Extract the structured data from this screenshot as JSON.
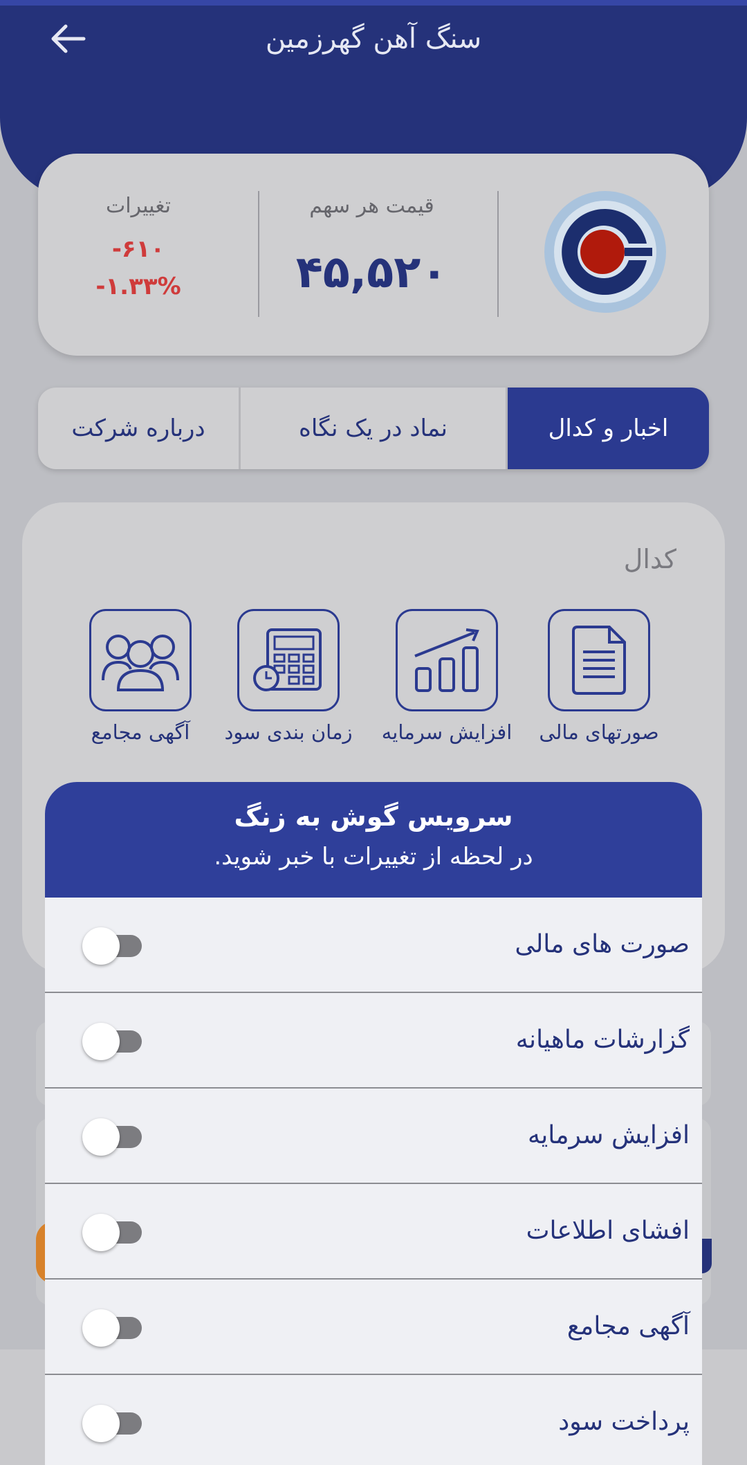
{
  "header": {
    "title": "سنگ آهن گهرزمین",
    "back_icon": "arrow-left-icon"
  },
  "price_card": {
    "logo": "company-logo",
    "price_label": "قیمت هر سهم",
    "price_value": "۴۵,۵۲۰",
    "change_label": "تغییرات",
    "change_abs": "-۶۱۰",
    "change_pct": "-۱.۳۳%",
    "change_color": "#cf3b3b"
  },
  "tabs": [
    {
      "label": "درباره شرکت",
      "active": false
    },
    {
      "label": "نماد در یک نگاه",
      "active": false
    },
    {
      "label": "اخبار و کدال",
      "active": true
    }
  ],
  "codal": {
    "title": "کدال",
    "items": [
      {
        "label": "صورتهای مالی",
        "icon": "document-icon"
      },
      {
        "label": "افزایش سرمایه",
        "icon": "growth-chart-icon"
      },
      {
        "label": "زمان بندی سود",
        "icon": "calculator-clock-icon"
      },
      {
        "label": "آگهی مجامع",
        "icon": "group-people-icon"
      }
    ]
  },
  "sheet": {
    "title": "سرویس گوش به زنگ",
    "subtitle": "در لحظه از تغییرات با خبر شوید.",
    "rows": [
      {
        "label": "صورت های مالی",
        "enabled": false
      },
      {
        "label": "گزارشات ماهیانه",
        "enabled": false
      },
      {
        "label": "افزایش سرمایه",
        "enabled": false
      },
      {
        "label": "افشای اطلاعات",
        "enabled": false
      },
      {
        "label": "آگهی مجامع",
        "enabled": false
      },
      {
        "label": "پرداخت سود",
        "enabled": false
      }
    ]
  },
  "colors": {
    "primary": "#25327a",
    "accent": "#2f3f9a",
    "negative": "#cf3b3b"
  }
}
